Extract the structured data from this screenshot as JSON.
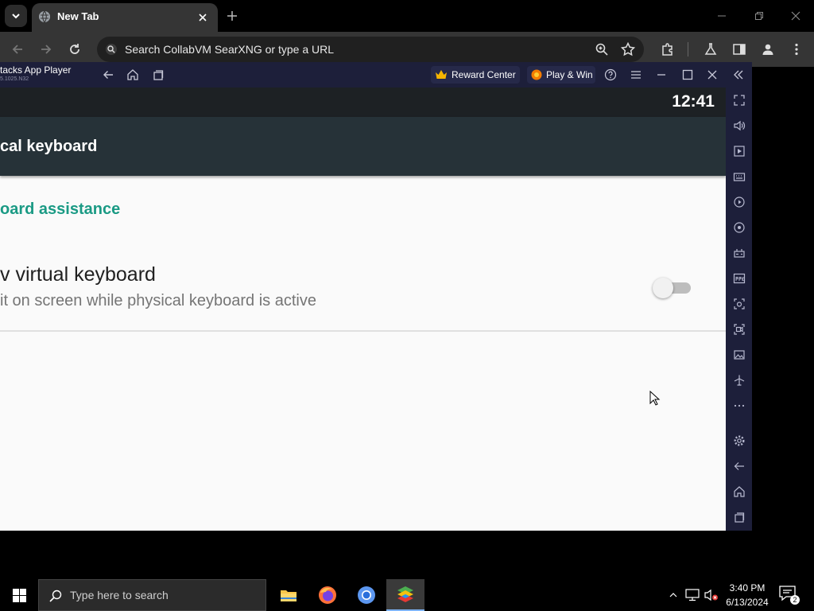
{
  "browser": {
    "tab": {
      "title": "New Tab"
    },
    "omnibox": {
      "placeholder": "Search CollabVM SearXNG or type a URL"
    }
  },
  "bluestacks": {
    "title": "tacks App Player",
    "version": "5.1025.N32",
    "reward_center": "Reward Center",
    "play_and_win": "Play & Win",
    "sidebar_icons": [
      "fullscreen-icon",
      "volume-icon",
      "media-icon",
      "keyboard-icon",
      "record-icon",
      "rotate-icon",
      "gamepad-icon",
      "apk-icon",
      "screenshot-icon",
      "screen-record-icon",
      "gallery-icon",
      "airplane-icon",
      "more-icon",
      "settings-icon",
      "back-icon",
      "home-icon",
      "recents-icon"
    ]
  },
  "android": {
    "clock": "12:41",
    "appbar_title": "cal keyboard",
    "section_header": "oard assistance",
    "preference": {
      "title": "v virtual keyboard",
      "summary": "it on screen while physical keyboard is active",
      "enabled": false
    }
  },
  "taskbar": {
    "search_placeholder": "Type here to search",
    "time": "3:40 PM",
    "date": "6/13/2024",
    "notification_count": "2"
  },
  "colors": {
    "accent_teal": "#1a9a84",
    "appbar": "#263238",
    "bluestacks_frame": "#1d1f3a"
  }
}
